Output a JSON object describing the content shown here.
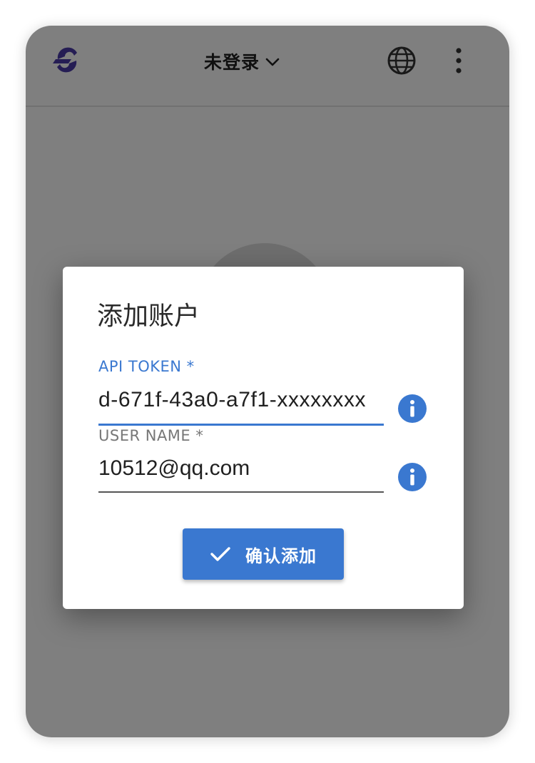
{
  "header": {
    "account_label": "未登录"
  },
  "dialog": {
    "title": "添加账户",
    "token_label": "API TOKEN *",
    "token_value": "d-671f-43a0-a7f1-xxxxxxxx",
    "user_label": "USER NAME *",
    "user_value": "10512@qq.com",
    "confirm_label": "确认添加"
  },
  "icons": {
    "logo": "logo-icon",
    "account_dropdown": "chevron-down-icon",
    "language": "globe-icon",
    "menu": "more-vert-icon",
    "field_info": "info-icon",
    "confirm": "check-icon"
  },
  "colors": {
    "accent": "#3a78d0",
    "logo": "#4a3aa8",
    "overlay": "rgba(0,0,0,0.5)"
  }
}
